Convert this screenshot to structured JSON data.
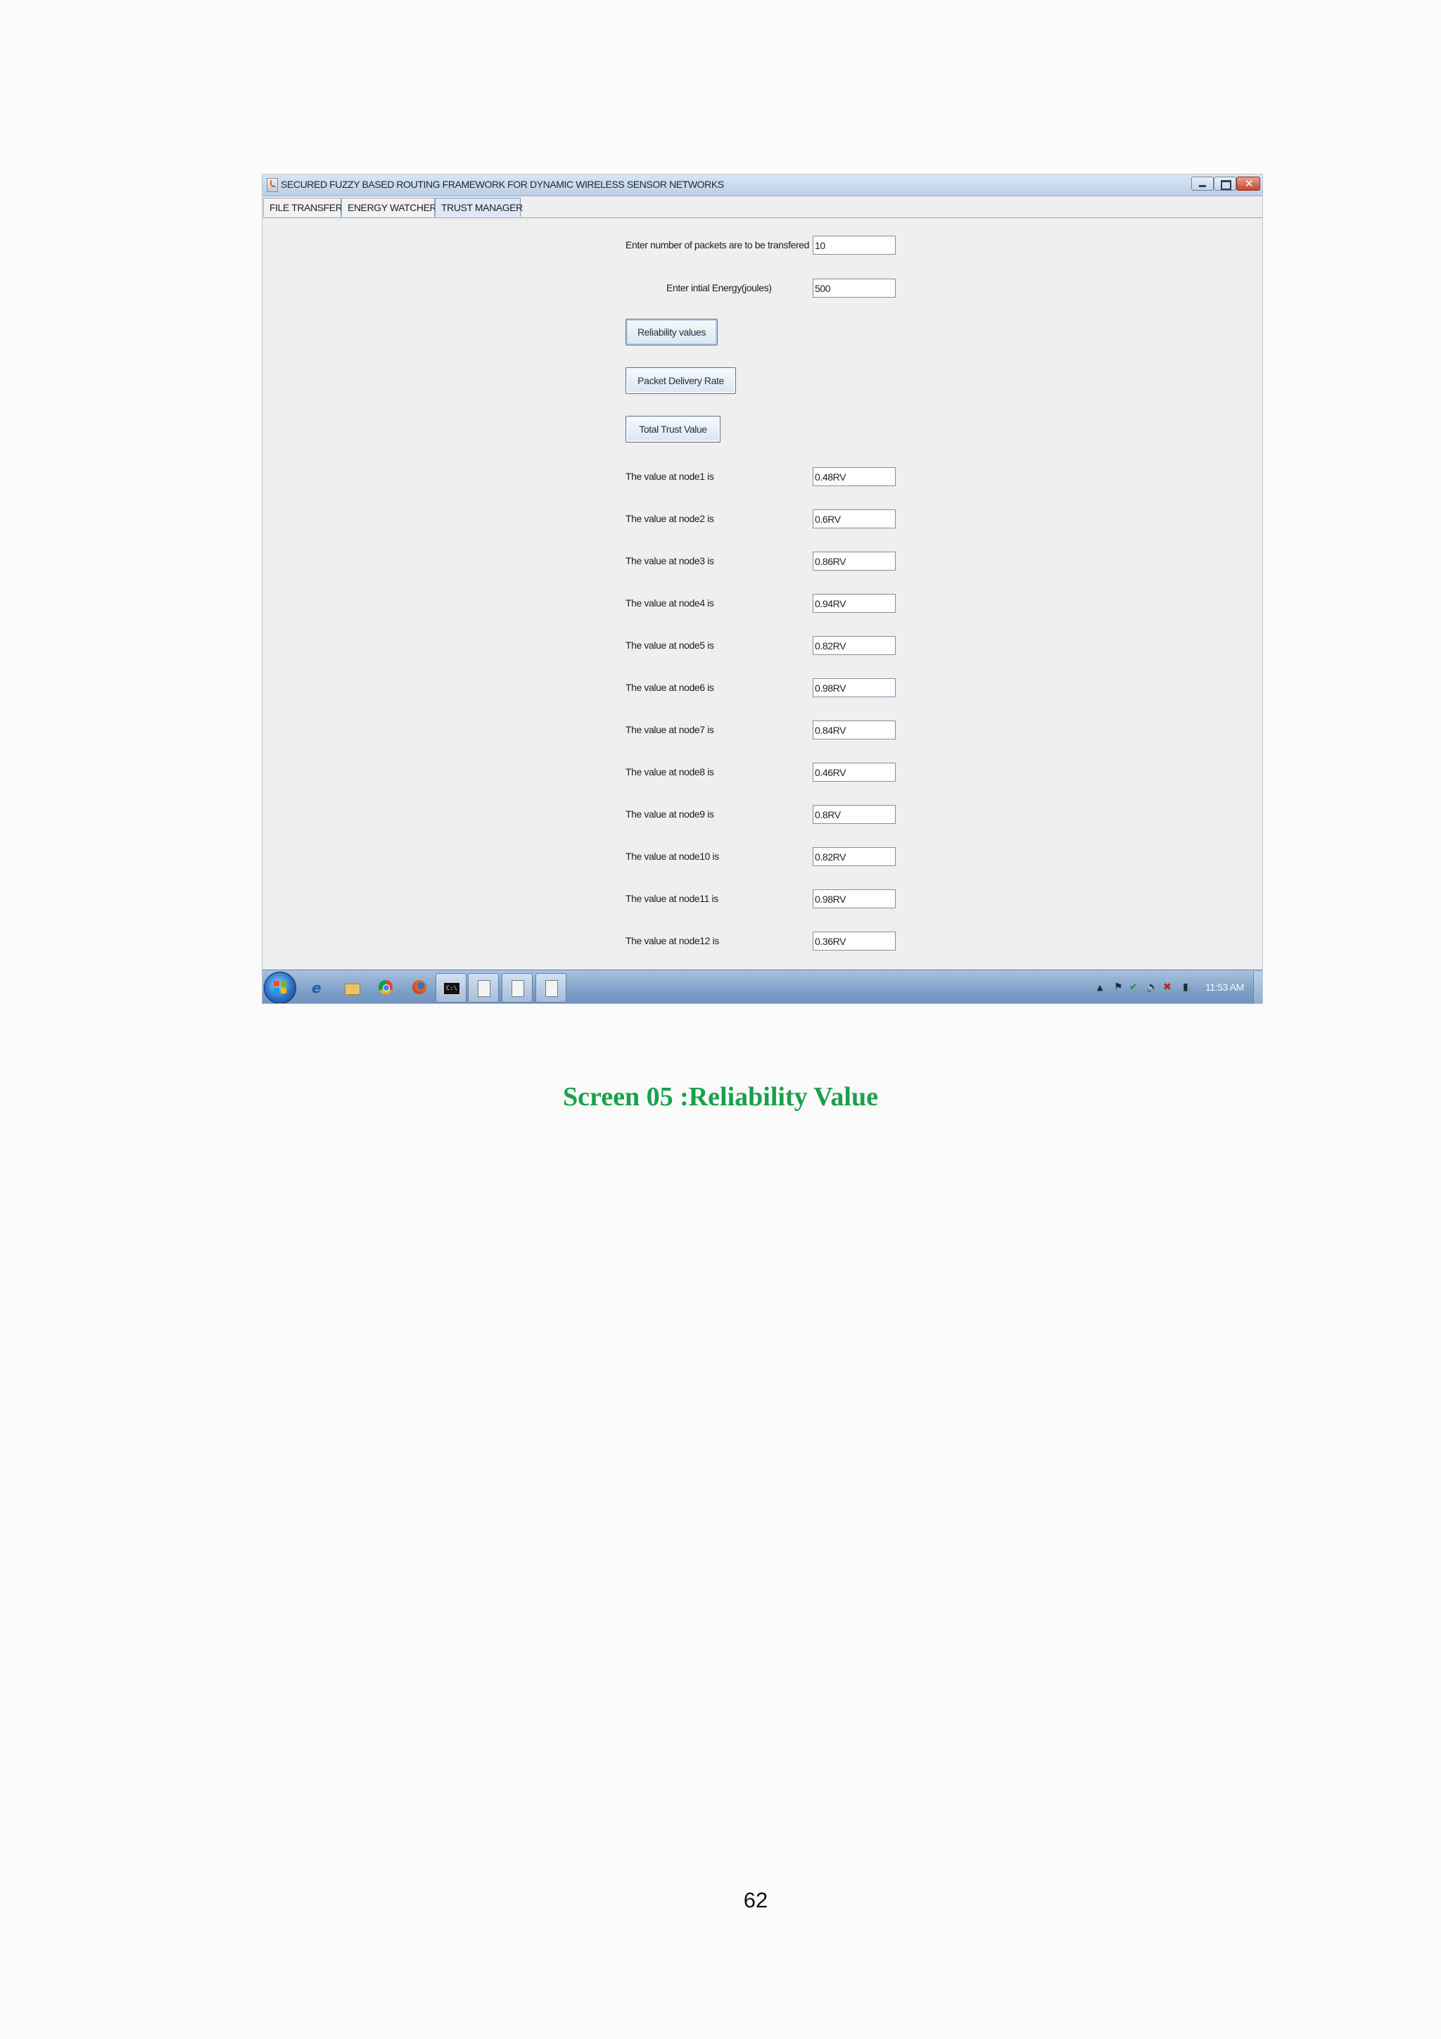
{
  "window": {
    "title": "SECURED FUZZY BASED ROUTING FRAMEWORK FOR DYNAMIC WIRELESS SENSOR NETWORKS"
  },
  "tabs": [
    {
      "label": "FILE TRANSFER",
      "active": false
    },
    {
      "label": "ENERGY WATCHER",
      "active": false
    },
    {
      "label": "TRUST MANAGER",
      "active": true
    }
  ],
  "form": {
    "packets_label": "Enter number of packets are to be transfered",
    "packets_value": "10",
    "energy_label": "Enter intial Energy(joules)",
    "energy_value": "500",
    "buttons": {
      "reliability": "Reliability values",
      "pdr": "Packet Delivery Rate",
      "trust": "Total Trust Value"
    }
  },
  "nodes": [
    {
      "label": "The value at  node1 is",
      "value": "0.48RV"
    },
    {
      "label": "The value at  node2 is",
      "value": "0.6RV"
    },
    {
      "label": "The value at  node3 is",
      "value": "0.86RV"
    },
    {
      "label": "The value at  node4 is",
      "value": "0.94RV"
    },
    {
      "label": "The value at  node5 is",
      "value": "0.82RV"
    },
    {
      "label": "The value at  node6 is",
      "value": "0.98RV"
    },
    {
      "label": "The value at  node7 is",
      "value": "0.84RV"
    },
    {
      "label": "The value at  node8 is",
      "value": "0.46RV"
    },
    {
      "label": "The value at  node9 is",
      "value": "0.8RV"
    },
    {
      "label": "The value at node10 is",
      "value": "0.82RV"
    },
    {
      "label": "The value at node11 is",
      "value": "0.98RV"
    },
    {
      "label": "The value at node12 is",
      "value": "0.36RV"
    }
  ],
  "taskbar": {
    "clock": "11:53 AM",
    "pinned_icons": [
      "ie-icon",
      "explorer-icon",
      "chrome-icon",
      "firefox-icon",
      "cmd-icon"
    ],
    "open_tasks": [
      "java-window-1",
      "java-window-2",
      "java-window-3"
    ]
  },
  "caption": "Screen 05 :Reliability Value",
  "page_number": "62",
  "colors": {
    "caption": "#1aa04b",
    "taskbar": "#7d9fc6",
    "titlebar": "#c9d9ec"
  }
}
